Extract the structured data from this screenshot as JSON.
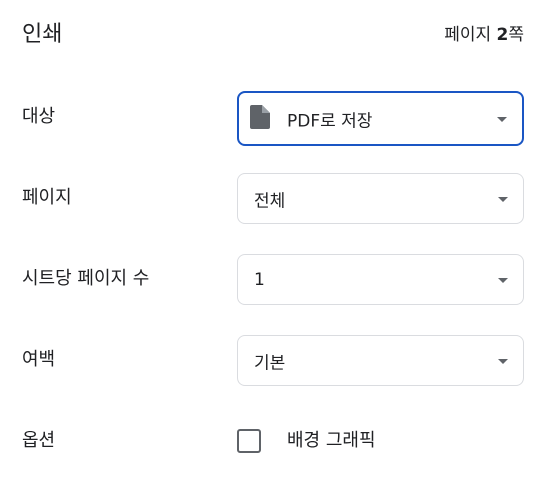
{
  "header": {
    "title": "인쇄",
    "page_count_prefix": "페이지 ",
    "page_count_number": "2",
    "page_count_suffix": "쪽"
  },
  "destination": {
    "label": "대상",
    "value": "PDF로 저장",
    "icon": "document-icon"
  },
  "pages": {
    "label": "페이지",
    "value": "전체"
  },
  "pages_per_sheet": {
    "label": "시트당 페이지 수",
    "value": "1"
  },
  "margins": {
    "label": "여백",
    "value": "기본"
  },
  "options": {
    "label": "옵션",
    "background_graphics_label": "배경 그래픽",
    "background_graphics_checked": false
  },
  "colors": {
    "focus_border": "#1a56c4",
    "border": "#dadce0",
    "text": "#202124",
    "icon": "#5f6368"
  }
}
